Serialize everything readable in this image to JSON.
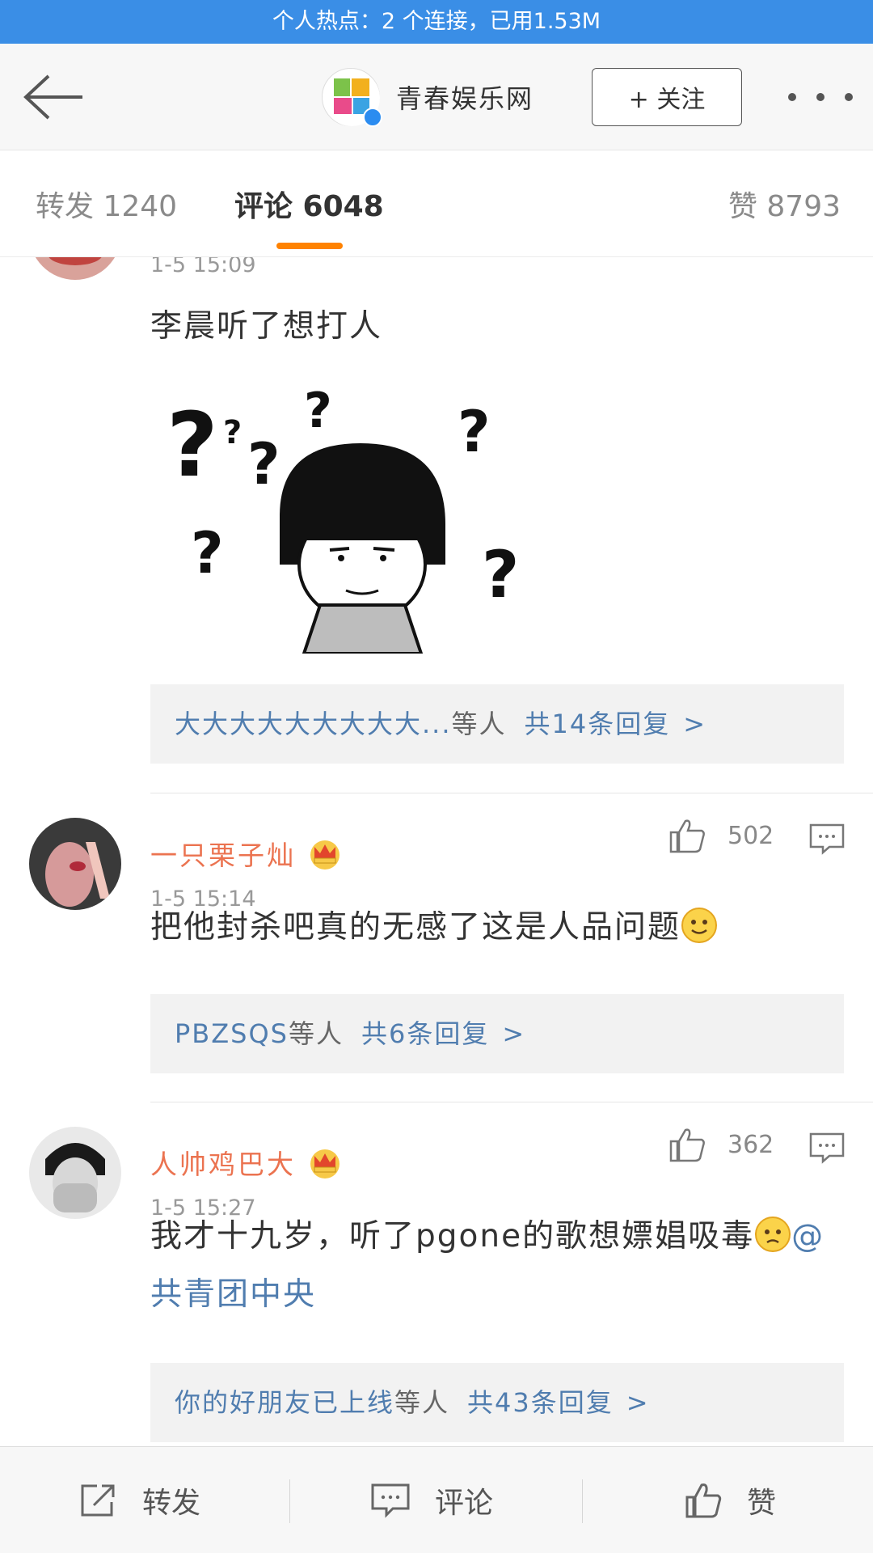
{
  "status": {
    "hotspot_text": "个人热点：2 个连接，已用1.53M"
  },
  "header": {
    "account_name": "青春娱乐网",
    "follow_label": "+ 关注"
  },
  "tabs": {
    "repost": "转发 1240",
    "comment": "评论 6048",
    "like": "赞 8793"
  },
  "comments": [
    {
      "time": "1-5 15:09",
      "text": "李晨听了想打人",
      "replies": {
        "names": "大大大大大大大大大...",
        "others": "等人",
        "count": "共14条回复",
        "arrow": ">"
      }
    },
    {
      "username": "一只栗子灿",
      "time": "1-5 15:14",
      "likes": "502",
      "text": "把他封杀吧真的无感了这是人品问题",
      "replies": {
        "names": "PBZSQS",
        "others": "等人",
        "count": "共6条回复",
        "arrow": ">"
      }
    },
    {
      "username": "人帅鸡巴大",
      "time": "1-5 15:27",
      "likes": "362",
      "text": "我才十九岁，听了pgone的歌想嫖娼吸毒",
      "mention": "@共青团中央",
      "replies": {
        "names": "你的好朋友已上线",
        "others": "等人",
        "count": "共43条回复",
        "arrow": ">"
      }
    }
  ],
  "bottombar": {
    "repost": "转发",
    "comment": "评论",
    "like": "赞"
  },
  "colors": {
    "hotspot": "#3a8ee6",
    "accent": "#ff8200",
    "username": "#eb7350",
    "link": "#507daf"
  },
  "icons": [
    "back-arrow-icon",
    "more-icon",
    "thumbs-up-icon",
    "reply-icon",
    "crown-icon",
    "smile-emoji-icon",
    "sad-emoji-icon",
    "repost-icon",
    "comment-icon",
    "like-icon"
  ]
}
